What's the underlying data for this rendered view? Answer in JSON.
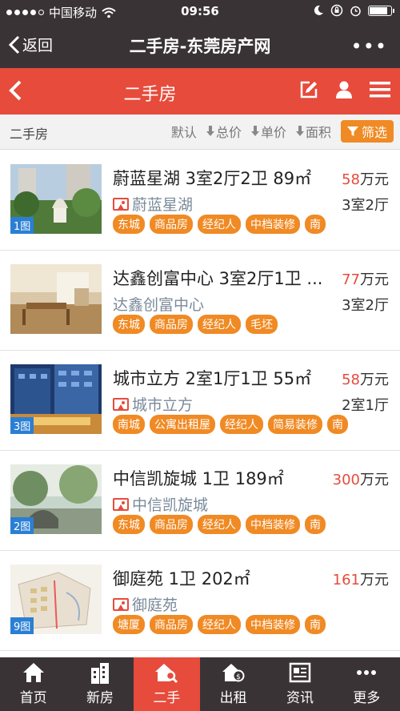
{
  "status": {
    "carrier": "中国移动",
    "time": "09:56"
  },
  "nav": {
    "back_label": "返回",
    "title": "二手房-东莞房产网"
  },
  "header": {
    "title": "二手房"
  },
  "filter": {
    "crumb": "二手房",
    "sorts": [
      {
        "label": "默认"
      },
      {
        "label": "总价"
      },
      {
        "label": "单价"
      },
      {
        "label": "面积"
      }
    ],
    "filter_label": "筛选"
  },
  "listings": [
    {
      "title": "蔚蓝星湖 3室2厅2卫 89㎡",
      "price": "58",
      "unit": "万元",
      "community": "蔚蓝星湖",
      "layout": "3室2厅",
      "badge": "1图",
      "tags": [
        "东城",
        "商品房",
        "经纪人",
        "中档装修",
        "南"
      ]
    },
    {
      "title": "达鑫创富中心 3室2厅1卫 ...",
      "price": "77",
      "unit": "万元",
      "community": "达鑫创富中心",
      "layout": "3室2厅",
      "badge": "",
      "tags": [
        "东城",
        "商品房",
        "经纪人",
        "毛坯"
      ]
    },
    {
      "title": "城市立方 2室1厅1卫 55㎡",
      "price": "58",
      "unit": "万元",
      "community": "城市立方",
      "layout": "2室1厅",
      "badge": "3图",
      "tags": [
        "南城",
        "公寓出租屋",
        "经纪人",
        "简易装修",
        "南"
      ]
    },
    {
      "title": "中信凯旋城 1卫 189㎡",
      "price": "300",
      "unit": "万元",
      "community": "中信凯旋城",
      "layout": "",
      "badge": "2图",
      "tags": [
        "东城",
        "商品房",
        "经纪人",
        "中档装修",
        "南"
      ]
    },
    {
      "title": "御庭苑 1卫 202㎡",
      "price": "161",
      "unit": "万元",
      "community": "御庭苑",
      "layout": "",
      "badge": "9图",
      "tags": [
        "塘厦",
        "商品房",
        "经纪人",
        "中档装修",
        "南"
      ]
    }
  ],
  "tabs": [
    {
      "label": "首页",
      "icon": "home-icon"
    },
    {
      "label": "新房",
      "icon": "building-icon"
    },
    {
      "label": "二手",
      "icon": "house-search-icon"
    },
    {
      "label": "出租",
      "icon": "house-coin-icon"
    },
    {
      "label": "资讯",
      "icon": "news-icon"
    },
    {
      "label": "更多",
      "icon": "more-dots-icon"
    }
  ],
  "colors": {
    "accent": "#e64b3c",
    "tag": "#f08a24",
    "dark": "#3a3336",
    "badge": "#2a7fd4"
  }
}
